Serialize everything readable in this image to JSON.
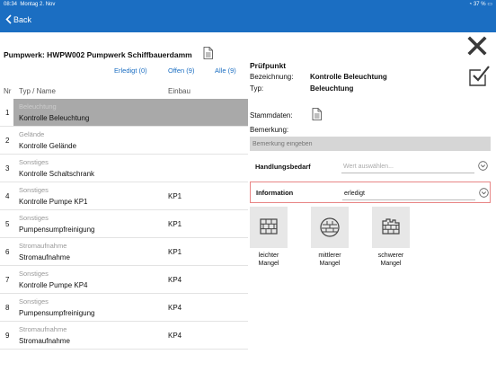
{
  "statusbar": {
    "time": "08:34",
    "date": "Montag 2. Nov",
    "battery": "37 %"
  },
  "nav": {
    "back_label": "Back"
  },
  "left": {
    "title": "Pumpwerk: HWPW002 Pumpwerk Schiffbauerdamm",
    "filters": {
      "done": "Erledigt (0)",
      "open": "Offen (9)",
      "all": "Alle (9)"
    },
    "columns": {
      "nr": "Nr",
      "type_name": "Typ / Name",
      "einbau": "Einbau"
    },
    "rows": [
      {
        "nr": "1",
        "category": "Beleuchtung",
        "name": "Kontrolle Beleuchtung",
        "einbau": "",
        "selected": true
      },
      {
        "nr": "2",
        "category": "Gelände",
        "name": "Kontrolle Gelände",
        "einbau": ""
      },
      {
        "nr": "3",
        "category": "Sonstiges",
        "name": "Kontrolle Schaltschrank",
        "einbau": ""
      },
      {
        "nr": "4",
        "category": "Sonstiges",
        "name": "Kontrolle Pumpe KP1",
        "einbau": "KP1"
      },
      {
        "nr": "5",
        "category": "Sonstiges",
        "name": "Pumpensumpfreinigung",
        "einbau": "KP1"
      },
      {
        "nr": "6",
        "category": "Stromaufnahme",
        "name": "Stromaufnahme",
        "einbau": "KP1"
      },
      {
        "nr": "7",
        "category": "Sonstiges",
        "name": "Kontrolle Pumpe KP4",
        "einbau": "KP4"
      },
      {
        "nr": "8",
        "category": "Sonstiges",
        "name": "Pumpensumpfreinigung",
        "einbau": "KP4"
      },
      {
        "nr": "9",
        "category": "Stromaufnahme",
        "name": "Stromaufnahme",
        "einbau": "KP4"
      }
    ]
  },
  "right": {
    "title": "Prüfpunkt",
    "bezeichnung_label": "Bezeichnung:",
    "bezeichnung_value": "Kontrolle Beleuchtung",
    "typ_label": "Typ:",
    "typ_value": "Beleuchtung",
    "stammdaten_label": "Stammdaten:",
    "bemerkung_label": "Bemerkung:",
    "bemerkung_placeholder": "Bemerkung eingeben",
    "handlungsbedarf": {
      "label": "Handlungsbedarf",
      "placeholder": "Wert auswählen..."
    },
    "information": {
      "label": "Information",
      "value": "erledigt"
    },
    "mangel": [
      {
        "label_1": "leichter",
        "label_2": "Mangel"
      },
      {
        "label_1": "mittlerer",
        "label_2": "Mangel"
      },
      {
        "label_1": "schwerer",
        "label_2": "Mangel"
      }
    ]
  },
  "colors": {
    "accent": "#1b6ec2",
    "selected_row": "#a9a9a9",
    "highlight_border": "#e88585"
  }
}
